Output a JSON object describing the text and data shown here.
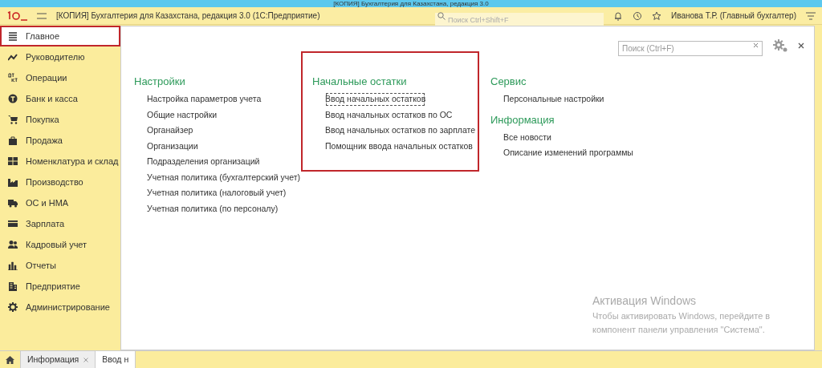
{
  "window": {
    "title": "[КОПИЯ] Бухгалтерия для Казахстана, редакция 3.0"
  },
  "toolbar": {
    "app_title": "[КОПИЯ] Бухгалтерия для Казахстана, редакция 3.0  (1С:Предприятие)",
    "search_placeholder": "Поиск Ctrl+Shift+F",
    "user": "Иванова Т.Р. (Главный бухгалтер)"
  },
  "sidebar": {
    "items": [
      {
        "label": "Главное",
        "selected": true,
        "highlighted": true
      },
      {
        "label": "Руководителю",
        "selected": false,
        "highlighted": false
      },
      {
        "label": "Операции",
        "selected": false,
        "highlighted": false
      },
      {
        "label": "Банк и касса",
        "selected": false,
        "highlighted": false
      },
      {
        "label": "Покупка",
        "selected": false,
        "highlighted": false
      },
      {
        "label": "Продажа",
        "selected": false,
        "highlighted": false
      },
      {
        "label": "Номенклатура и склад",
        "selected": false,
        "highlighted": false
      },
      {
        "label": "Производство",
        "selected": false,
        "highlighted": false
      },
      {
        "label": "ОС и НМА",
        "selected": false,
        "highlighted": false
      },
      {
        "label": "Зарплата",
        "selected": false,
        "highlighted": false
      },
      {
        "label": "Кадровый учет",
        "selected": false,
        "highlighted": false
      },
      {
        "label": "Отчеты",
        "selected": false,
        "highlighted": false
      },
      {
        "label": "Предприятие",
        "selected": false,
        "highlighted": false
      },
      {
        "label": "Администрирование",
        "selected": false,
        "highlighted": false
      }
    ]
  },
  "panel": {
    "search_placeholder": "Поиск (Ctrl+F)",
    "columns": [
      [
        {
          "title": "Настройки",
          "highlighted": false,
          "links": [
            {
              "label": "Настройка параметров учета",
              "focused": false
            },
            {
              "label": "Общие настройки",
              "focused": false
            },
            {
              "label": "Органайзер",
              "focused": false
            },
            {
              "label": "Организации",
              "focused": false
            },
            {
              "label": "Подразделения организаций",
              "focused": false
            },
            {
              "label": "Учетная политика (бухгалтерский учет)",
              "focused": false
            },
            {
              "label": "Учетная политика (налоговый учет)",
              "focused": false
            },
            {
              "label": "Учетная политика (по персоналу)",
              "focused": false
            }
          ]
        }
      ],
      [
        {
          "title": "Начальные остатки",
          "highlighted": true,
          "links": [
            {
              "label": "Ввод начальных остатков",
              "focused": true
            },
            {
              "label": "Ввод начальных остатков по ОС",
              "focused": false
            },
            {
              "label": "Ввод начальных остатков по зарплате",
              "focused": false
            },
            {
              "label": "Помощник ввода начальных остатков",
              "focused": false
            }
          ]
        }
      ],
      [
        {
          "title": "Сервис",
          "highlighted": false,
          "links": [
            {
              "label": "Персональные настройки",
              "focused": false
            }
          ]
        },
        {
          "title": "Информация",
          "highlighted": false,
          "links": [
            {
              "label": "Все новости",
              "focused": false
            },
            {
              "label": "Описание изменений программы",
              "focused": false
            }
          ]
        }
      ]
    ]
  },
  "activation_notice": {
    "title": "Активация Windows",
    "text": "Чтобы активировать Windows, перейдите в компонент панели управления \"Система\"."
  },
  "tabs": [
    {
      "label": "Информация",
      "selected": false,
      "closable": true
    },
    {
      "label": "Ввод н",
      "selected": true,
      "closable": false
    }
  ]
}
